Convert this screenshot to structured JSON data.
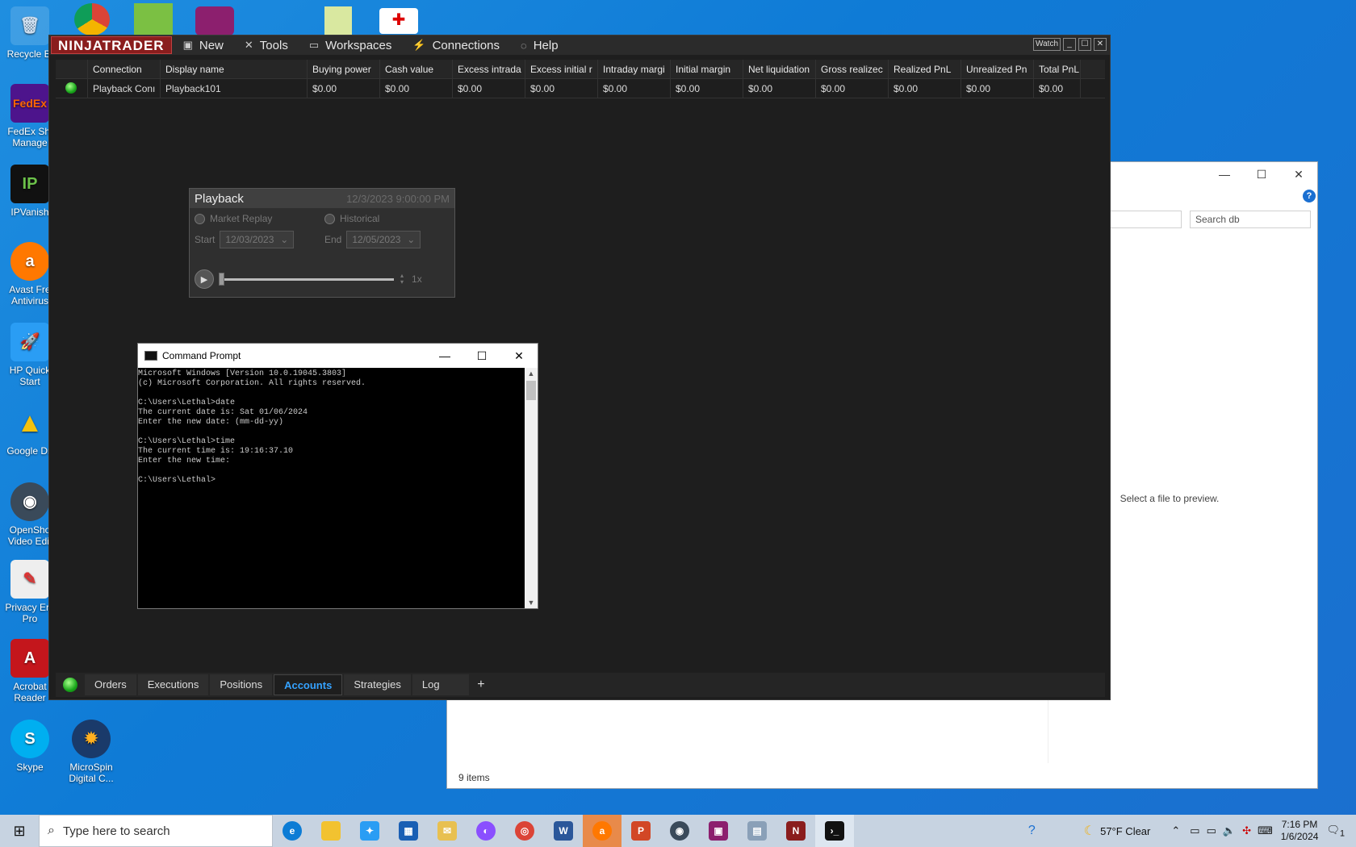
{
  "desktop": {
    "icons": [
      {
        "label": "Recycle Bi",
        "name": "recycle-bin-icon"
      },
      {
        "label": "FedEx Shi Manage",
        "name": "fedex-icon"
      },
      {
        "label": "IPVanish",
        "name": "ipvanish-icon"
      },
      {
        "label": "Avast Fre Antivirus",
        "name": "avast-icon"
      },
      {
        "label": "HP Quick Start",
        "name": "hp-quickstart-icon"
      },
      {
        "label": "Google Dri",
        "name": "google-drive-icon"
      },
      {
        "label": "OpenSho Video Edit",
        "name": "openshot-icon"
      },
      {
        "label": "Privacy Era Pro",
        "name": "privacy-eraser-icon"
      },
      {
        "label": "Acrobat Reader",
        "name": "acrobat-icon"
      },
      {
        "label": "Skype",
        "name": "skype-icon"
      },
      {
        "label": "MicroSpin Digital C...",
        "name": "microspin-icon"
      }
    ]
  },
  "explorer": {
    "search_placeholder": "Search db",
    "preview_text": "Select a file to preview.",
    "status": "9 items"
  },
  "ninjatrader": {
    "logo": "NINJATRADER",
    "menu": [
      "New",
      "Tools",
      "Workspaces",
      "Connections",
      "Help"
    ],
    "watch_label": "Watch",
    "columns": [
      "Connection",
      "Display name",
      "Buying power",
      "Cash value",
      "Excess intrada",
      "Excess initial r",
      "Intraday margi",
      "Initial margin",
      "Net liquidation",
      "Gross realizec",
      "Realized PnL",
      "Unrealized Pn",
      "Total PnL"
    ],
    "rows": [
      [
        "Playback Conı",
        "Playback101",
        "$0.00",
        "$0.00",
        "$0.00",
        "$0.00",
        "$0.00",
        "$0.00",
        "$0.00",
        "$0.00",
        "$0.00",
        "$0.00",
        "$0.00"
      ]
    ],
    "tabs": [
      "Orders",
      "Executions",
      "Positions",
      "Accounts",
      "Strategies",
      "Log"
    ],
    "active_tab": "Accounts",
    "plus": "+"
  },
  "playback": {
    "title": "Playback",
    "datetime": "12/3/2023 9:00:00 PM",
    "market_replay": "Market Replay",
    "historical": "Historical",
    "start_label": "Start",
    "start_value": "12/03/2023",
    "end_label": "End",
    "end_value": "12/05/2023",
    "speed": "1x"
  },
  "cmd": {
    "title": "Command Prompt",
    "lines": "Microsoft Windows [Version 10.0.19045.3803]\n(c) Microsoft Corporation. All rights reserved.\n\nC:\\Users\\Lethal>date\nThe current date is: Sat 01/06/2024\nEnter the new date: (mm-dd-yy)\n\nC:\\Users\\Lethal>time\nThe current time is: 19:16:37.10\nEnter the new time:\n\nC:\\Users\\Lethal>"
  },
  "taskbar": {
    "search_placeholder": "Type here to search",
    "weather": "57°F  Clear",
    "time": "7:16 PM",
    "date": "1/6/2024",
    "notifications": "1"
  }
}
